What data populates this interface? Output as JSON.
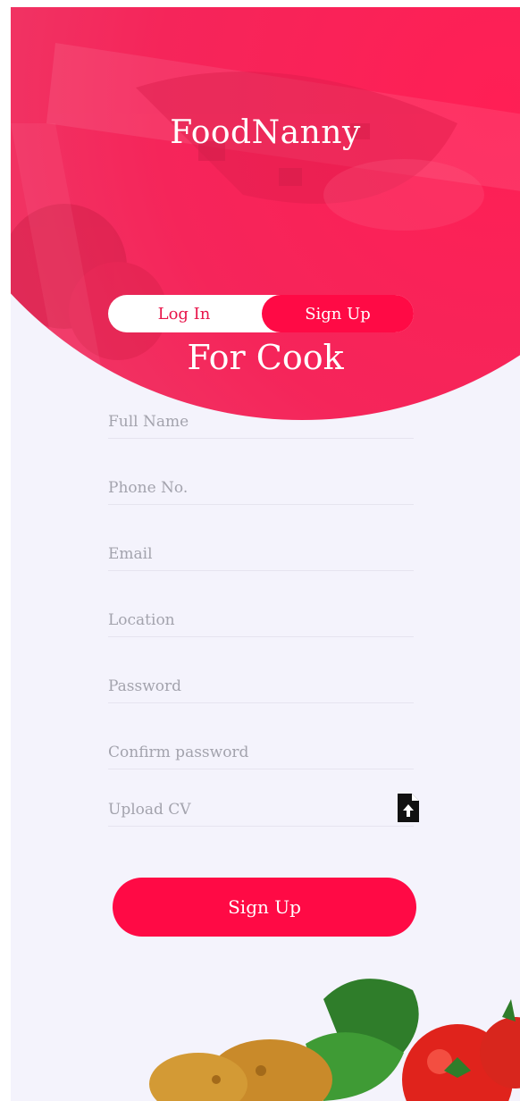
{
  "app": {
    "title": "FoodNanny"
  },
  "tabs": {
    "login_label": "Log In",
    "signup_label": "Sign Up",
    "active": "Sign Up"
  },
  "role_title": "For Cook",
  "form": {
    "fields": [
      {
        "label": "Full Name"
      },
      {
        "label": "Phone No."
      },
      {
        "label": "Email"
      },
      {
        "label": "Location"
      },
      {
        "label": "Password"
      },
      {
        "label": "Confirm password"
      },
      {
        "label": "Upload CV",
        "icon": "file-upload-icon"
      }
    ],
    "submit_label": "Sign Up"
  },
  "colors": {
    "accent": "#ff0a45",
    "background": "#f4f3fc",
    "placeholder": "#a3a3ad"
  }
}
